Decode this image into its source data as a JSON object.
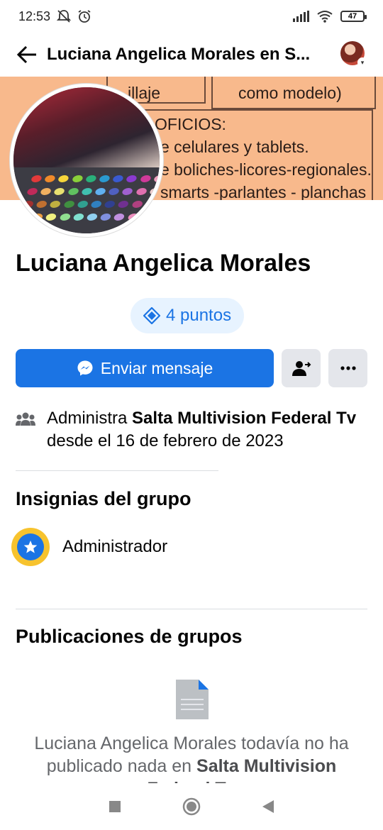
{
  "status_bar": {
    "time": "12:53",
    "battery": "47"
  },
  "header": {
    "title": "Luciana Angelica Morales en S..."
  },
  "cover": {
    "lines": [
      "illaje",
      "como modelo)",
      "OFICIOS:",
      "e celulares y tablets.",
      "e boliches-licores-regionales.",
      "smarts -parlantes - planchas"
    ]
  },
  "profile": {
    "name": "Luciana Angelica Morales",
    "points": "4 puntos"
  },
  "actions": {
    "send_message": "Enviar mensaje"
  },
  "admin_info": {
    "prefix": "Administra ",
    "group": "Salta Multivision Federal Tv",
    "suffix": " desde el 16 de febrero de 2023"
  },
  "badges": {
    "title": "Insignias del grupo",
    "items": [
      "Administrador"
    ]
  },
  "posts": {
    "title": "Publicaciones de grupos",
    "empty_prefix": "Luciana Angelica Morales todavía no ha publicado nada en ",
    "empty_group": "Salta Multivision Federal Tv"
  },
  "colors": {
    "accent": "#1b74e4",
    "badge_ring": "#f7c32e",
    "cover": "#f8b98c"
  }
}
